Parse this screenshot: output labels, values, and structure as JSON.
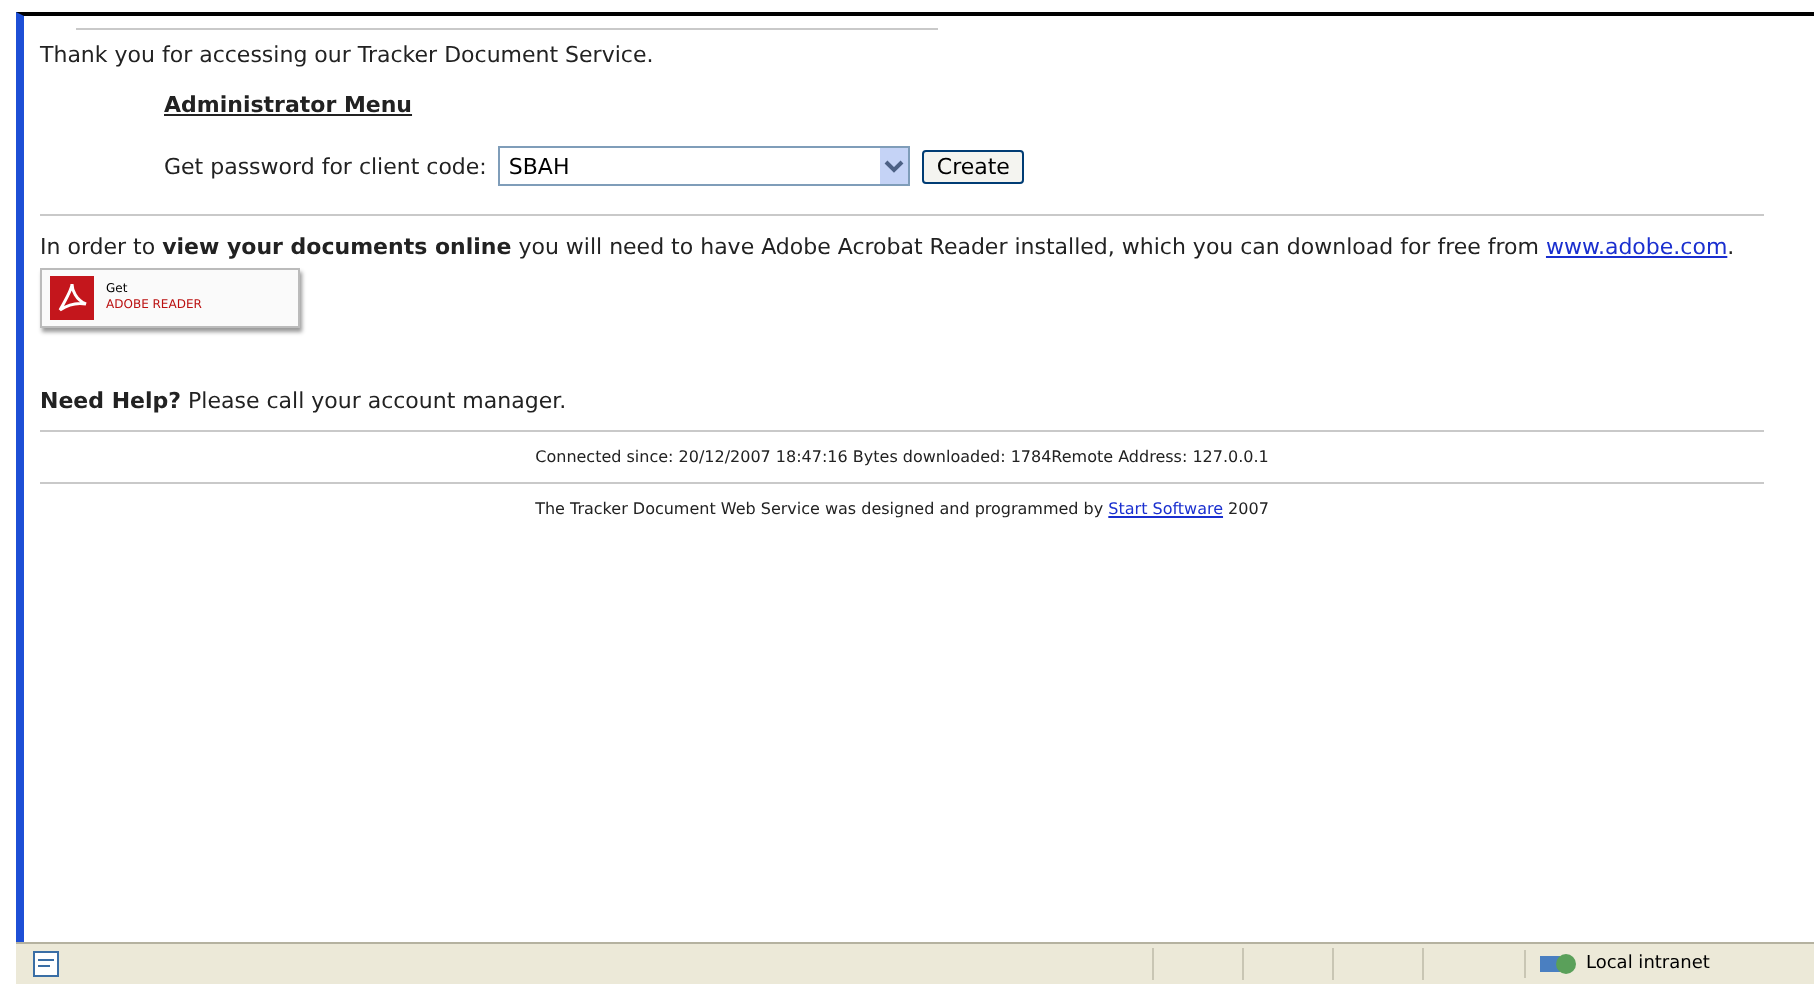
{
  "welcome": "Thank you for accessing our Tracker Document Service.",
  "admin_menu": {
    "title": "Administrator Menu",
    "label": "Get password for client code:",
    "client_code": "SBAH",
    "button": "Create"
  },
  "reader_notice": {
    "text": "In order to **view your documents online** you will need to have Adobe Acrobat Reader installed, which you can download for free from ",
    "link": "www.adobe.com",
    "after": "."
  },
  "reader_badge": {
    "line_1": "Get",
    "line_2": "ADOBE READER"
  },
  "help": "**Need Help?** Please call your account manager.",
  "connection": "Connected since: 20/12/2007 18:47:16 Bytes downloaded: 1784Remote Address: 127.0.0.1",
  "credit": {
    "text": "The Tracker Document Web Service was designed and programmed by ",
    "link": "Start Software",
    "after": " 2007"
  },
  "status_bar": {
    "zone": "Local intranet"
  }
}
